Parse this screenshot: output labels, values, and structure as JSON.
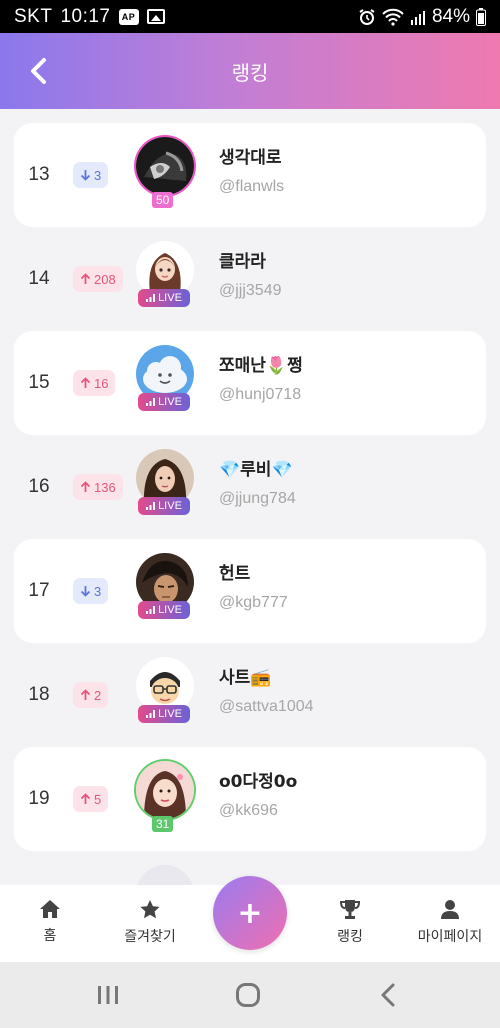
{
  "status_bar": {
    "carrier": "SKT",
    "time": "10:17",
    "app_badge": "AP",
    "battery": "84%"
  },
  "header": {
    "title": "랭킹",
    "back_icon": "chevron-left-icon"
  },
  "rankings": [
    {
      "rank": "13",
      "trend": "down",
      "change": "3",
      "name": "생각대로",
      "handle": "@flanwls",
      "status": "level",
      "level": "50",
      "level_color": "#ee6fd0"
    },
    {
      "rank": "14",
      "trend": "up",
      "change": "208",
      "name": "클라라",
      "handle": "@jjj3549",
      "status": "live",
      "live_label": "LIVE"
    },
    {
      "rank": "15",
      "trend": "up",
      "change": "16",
      "name": "쪼매난🌷쩡",
      "handle": "@hunj0718",
      "status": "live",
      "live_label": "LIVE"
    },
    {
      "rank": "16",
      "trend": "up",
      "change": "136",
      "name": "💎루비💎",
      "handle": "@jjung784",
      "status": "live",
      "live_label": "LIVE"
    },
    {
      "rank": "17",
      "trend": "down",
      "change": "3",
      "name": "헌트",
      "handle": "@kgb777",
      "status": "live",
      "live_label": "LIVE"
    },
    {
      "rank": "18",
      "trend": "up",
      "change": "2",
      "name": "사트📻",
      "handle": "@sattva1004",
      "status": "live",
      "live_label": "LIVE"
    },
    {
      "rank": "19",
      "trend": "up",
      "change": "5",
      "name": "o0다정0o",
      "handle": "@kk696",
      "status": "level",
      "level": "31",
      "level_color": "#5dc86b"
    }
  ],
  "bottom_nav": {
    "items": [
      {
        "label": "홈",
        "icon": "home-icon"
      },
      {
        "label": "즐겨찾기",
        "icon": "star-icon"
      },
      {
        "label": "랭킹",
        "icon": "trophy-icon"
      },
      {
        "label": "마이페이지",
        "icon": "person-icon"
      }
    ],
    "fab_label": "+"
  },
  "colors": {
    "header_gradient_start": "#8b78ec",
    "header_gradient_end": "#ef7ab0",
    "trend_up": "#e0587a",
    "trend_down": "#5d75d8"
  }
}
